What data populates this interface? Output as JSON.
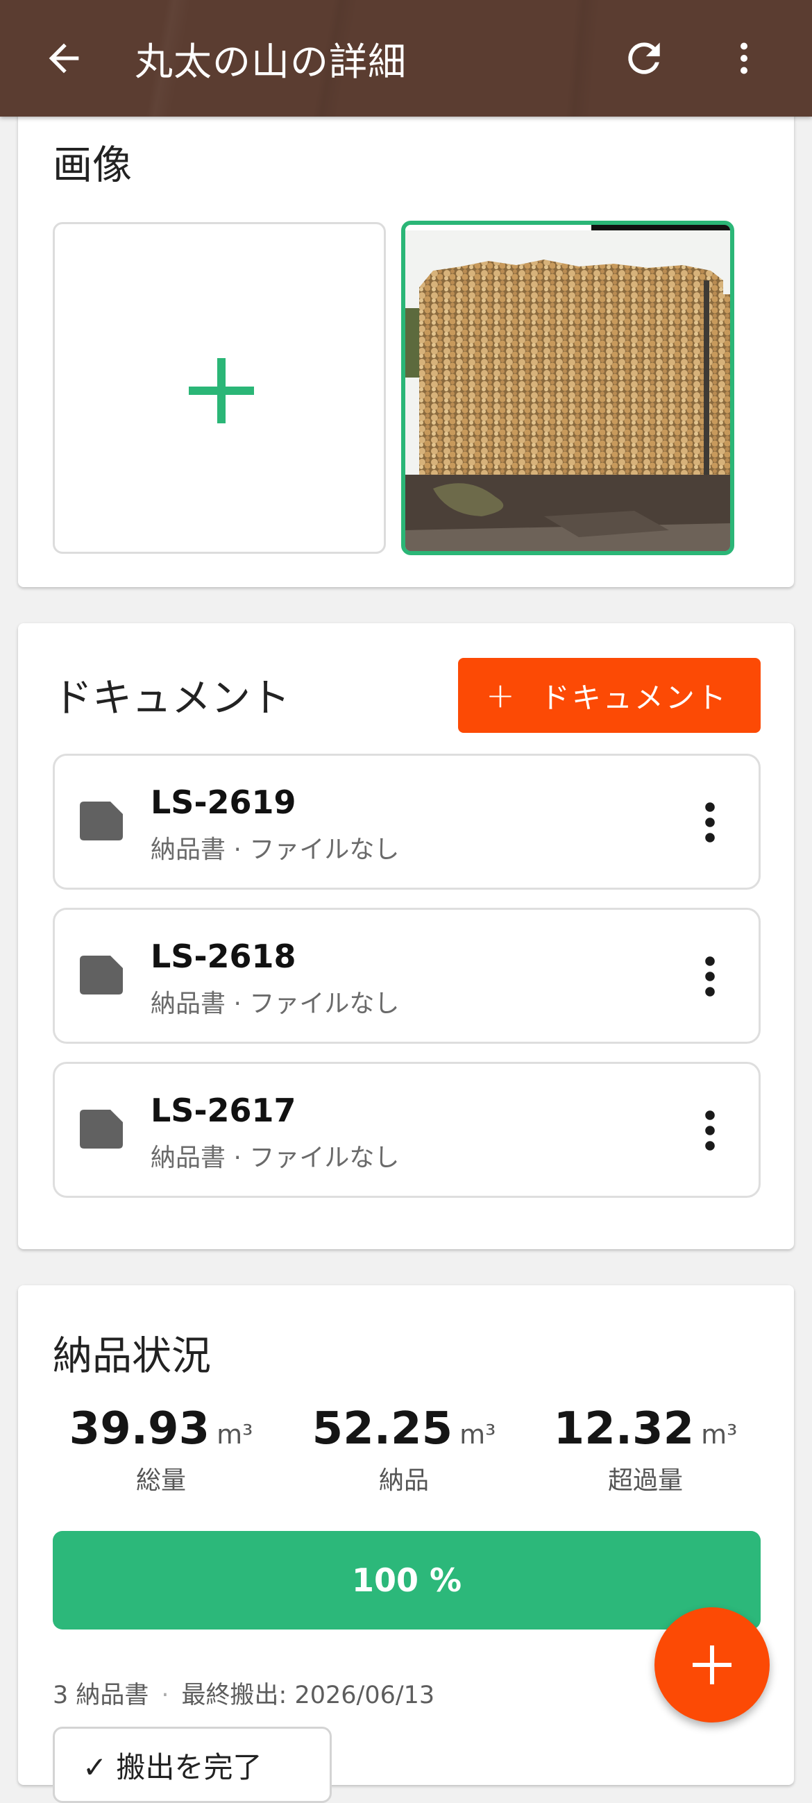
{
  "appbar": {
    "title": "丸太の山の詳細",
    "back_icon": "arrow-back-icon",
    "refresh_icon": "refresh-icon",
    "more_icon": "more-vert-icon"
  },
  "images": {
    "title": "画像",
    "add_icon": "plus-icon",
    "photo_desc": "stacked-logs-photo"
  },
  "documents": {
    "title": "ドキュメント",
    "add_button": {
      "icon": "+",
      "label": "ドキュメント"
    },
    "items": [
      {
        "id": "LS-2619",
        "subtitle": "納品書 · ファイルなし"
      },
      {
        "id": "LS-2618",
        "subtitle": "納品書 · ファイルなし"
      },
      {
        "id": "LS-2617",
        "subtitle": "納品書 · ファイルなし"
      }
    ]
  },
  "status": {
    "title": "納品状況",
    "stats": [
      {
        "value": "39.93",
        "unit": "m³",
        "label": "総量"
      },
      {
        "value": "52.25",
        "unit": "m³",
        "label": "納品"
      },
      {
        "value": "12.32",
        "unit": "m³",
        "label": "超過量"
      }
    ],
    "progress": {
      "percent": 100,
      "label": "100 %"
    },
    "meta": {
      "count": "3 納品書",
      "last": "最終搬出: 2026/06/13"
    },
    "complete_button": "✓ 搬出を完了"
  },
  "colors": {
    "accent_green": "#2bb677",
    "accent_orange": "#fc4a05",
    "appbar_brown": "#5b3d31"
  },
  "fab": {
    "icon": "plus-icon"
  }
}
